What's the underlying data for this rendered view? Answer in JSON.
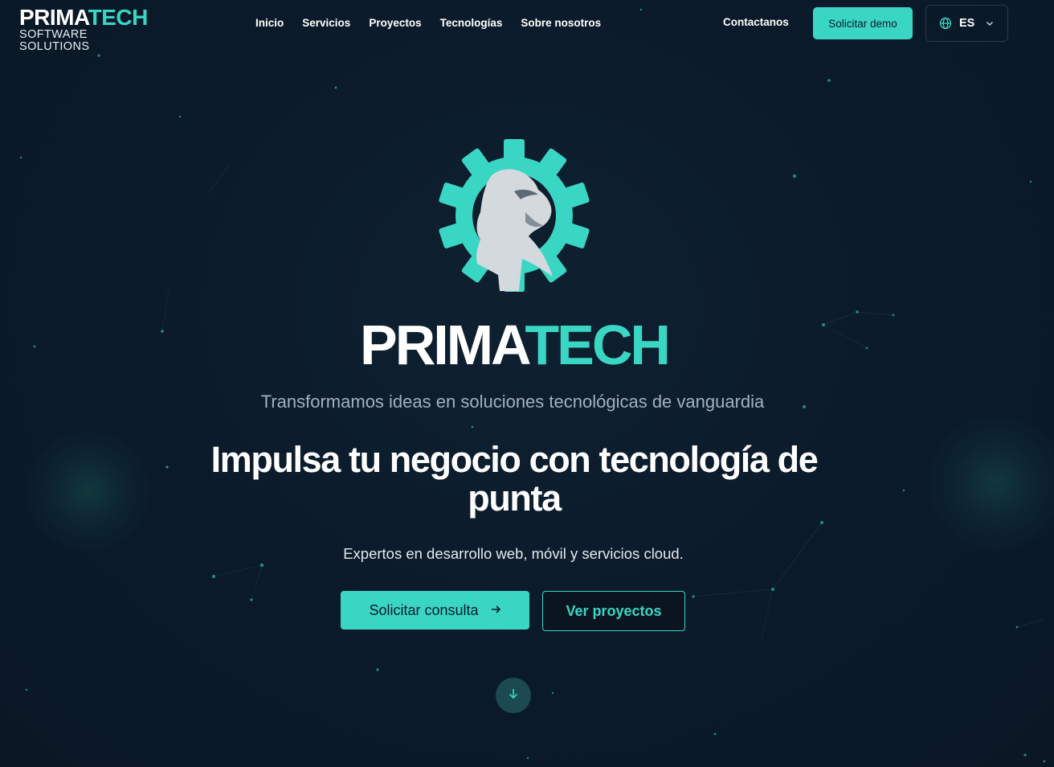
{
  "header": {
    "logo": {
      "word_white": "PRIMA",
      "word_teal": "TECH",
      "sub": "SOFTWARE SOLUTIONS"
    },
    "nav": [
      {
        "label": "Inicio"
      },
      {
        "label": "Servicios"
      },
      {
        "label": "Proyectos"
      },
      {
        "label": "Tecnologías"
      },
      {
        "label": "Sobre nosotros"
      }
    ],
    "contact_label": "Contactanos",
    "demo_label": "Solicitar demo",
    "language": {
      "code": "ES",
      "icon": "globe-icon",
      "chevron": "chevron-down-icon"
    }
  },
  "hero": {
    "emblem_icon": "gear-ape-logo",
    "brand_white": "PRIMA",
    "brand_teal": "TECH",
    "tagline": "Transformamos ideas en soluciones tecnológicas de vanguardia",
    "headline": "Impulsa tu negocio con tecnología de punta",
    "subline": "Expertos en desarrollo web, móvil y servicios cloud.",
    "primary_cta": {
      "label": "Solicitar consulta",
      "icon": "arrow-right-icon"
    },
    "secondary_cta": {
      "label": "Ver proyectos"
    },
    "scroll_icon": "arrow-down-icon"
  },
  "colors": {
    "background": "#0b1a2a",
    "accent": "#3ad6c4",
    "text": "#ffffff",
    "muted_text": "#a4b1bd"
  }
}
